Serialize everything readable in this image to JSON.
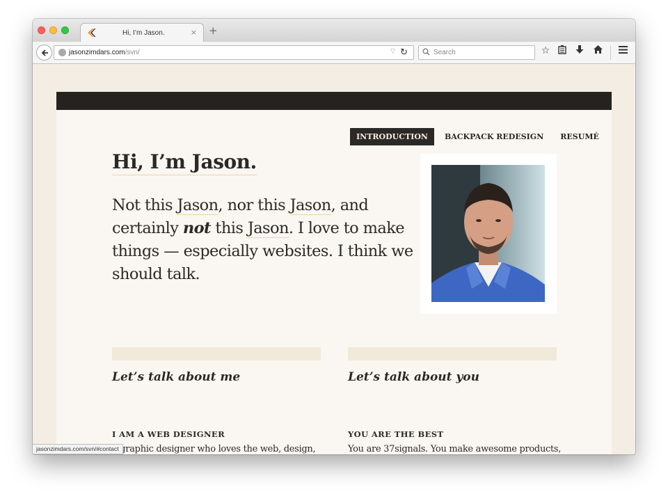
{
  "browser": {
    "tab_title": "Hi, I’m Jason.",
    "tab_close": "×",
    "new_tab": "+",
    "url_host": "jasonzimdars.com",
    "url_path": "/svn/",
    "search_placeholder": "Search",
    "status_url": "jasonzimdars.com/svn/#contact",
    "icons": [
      "back-arrow-icon",
      "globe-icon",
      "reload-icon",
      "search-icon",
      "bookmark-star-icon",
      "reading-list-icon",
      "download-icon",
      "home-icon",
      "menu-icon"
    ]
  },
  "site": {
    "nav": [
      {
        "label": "INTRODUCTION",
        "active": true
      },
      {
        "label": "BACKPACK REDESIGN",
        "active": false
      },
      {
        "label": "RESUMÉ",
        "active": false
      }
    ],
    "greeting": "Hi, I’m Jason.",
    "intro": {
      "p1": "Not this ",
      "jason1": "Jason",
      "p2": ", nor this ",
      "jason2": "Jason",
      "p3": ", and certainly ",
      "not": "not",
      "p4": " this ",
      "jason3": "Jason",
      "p5": ". I love to make things — especially websites. I think we should talk."
    },
    "sections": [
      {
        "title": "Let’s talk about me",
        "subheading": "I AM A WEB DESIGNER",
        "text": "a graphic designer who loves the web, design,"
      },
      {
        "title": "Let’s talk about you",
        "subheading": "YOU ARE THE BEST",
        "text": "You are 37signals. You make awesome products,"
      }
    ]
  },
  "colors": {
    "page_bg": "#f4ede4",
    "panel_bg": "#faf7f2",
    "dark": "#252320",
    "link_underline": "#e8d5a6"
  }
}
